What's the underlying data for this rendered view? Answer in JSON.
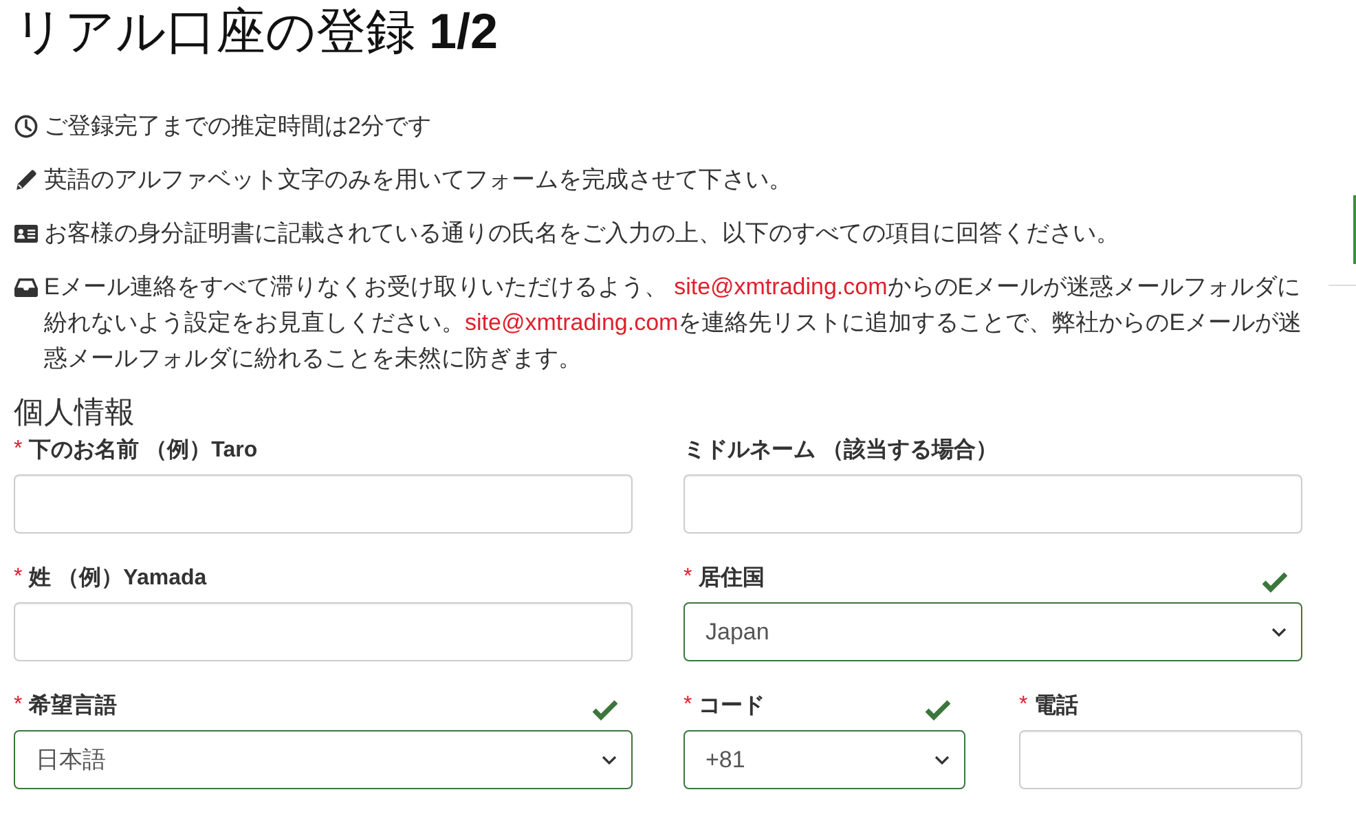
{
  "title": "リアル口座の登録 **1/2**",
  "notes": [
    {
      "parts": [
        {
          "kind": "text",
          "text": "ご登録完了までの推定時間は2分です"
        }
      ]
    },
    {
      "parts": [
        {
          "kind": "text",
          "text": "英語のアルファベット文字のみを用いてフォームを完成させて下さい。"
        }
      ]
    },
    {
      "parts": [
        {
          "kind": "text",
          "text": "お客様の身分証明書に記載されている通りの氏名をご入力の上、以下のすべての項目に回答ください。"
        }
      ]
    },
    {
      "parts": [
        {
          "kind": "text",
          "text": "Eメール連絡をすべて滞りなくお受け取りいただけるよう、 "
        },
        {
          "kind": "link",
          "text": "site@xmtrading.com"
        },
        {
          "kind": "text",
          "text": "からのEメールが迷惑メールフォルダに紛れないよう設定をお見直しください。"
        },
        {
          "kind": "link",
          "text": "site@xmtrading.com"
        },
        {
          "kind": "text",
          "text": "を連絡先リストに追加することで、弊社からのEメールが迷惑メールフォルダに紛れることを未然に防ぎます。"
        }
      ]
    }
  ],
  "section": {
    "heading": "個人情報",
    "rows": [
      [
        {
          "kind": "text",
          "mark": "*",
          "label": "下のお名前 （例）Taro"
        },
        {
          "kind": "text",
          "label": "ミドルネーム （該当する場合）"
        }
      ],
      [
        {
          "kind": "text",
          "mark": "*",
          "label": "姓 （例）Yamada"
        },
        {
          "kind": "select",
          "mark": "*",
          "label": "居住国",
          "value": "Japan",
          "valid": true
        }
      ],
      [
        {
          "kind": "select",
          "mark": "*",
          "label": "希望言語",
          "value": "日本語",
          "valid": true
        },
        {
          "kind": "select",
          "mark": "*",
          "label": "コード",
          "value": "+81",
          "valid": true
        },
        {
          "kind": "text",
          "mark": "*",
          "label": "電話"
        }
      ]
    ]
  }
}
